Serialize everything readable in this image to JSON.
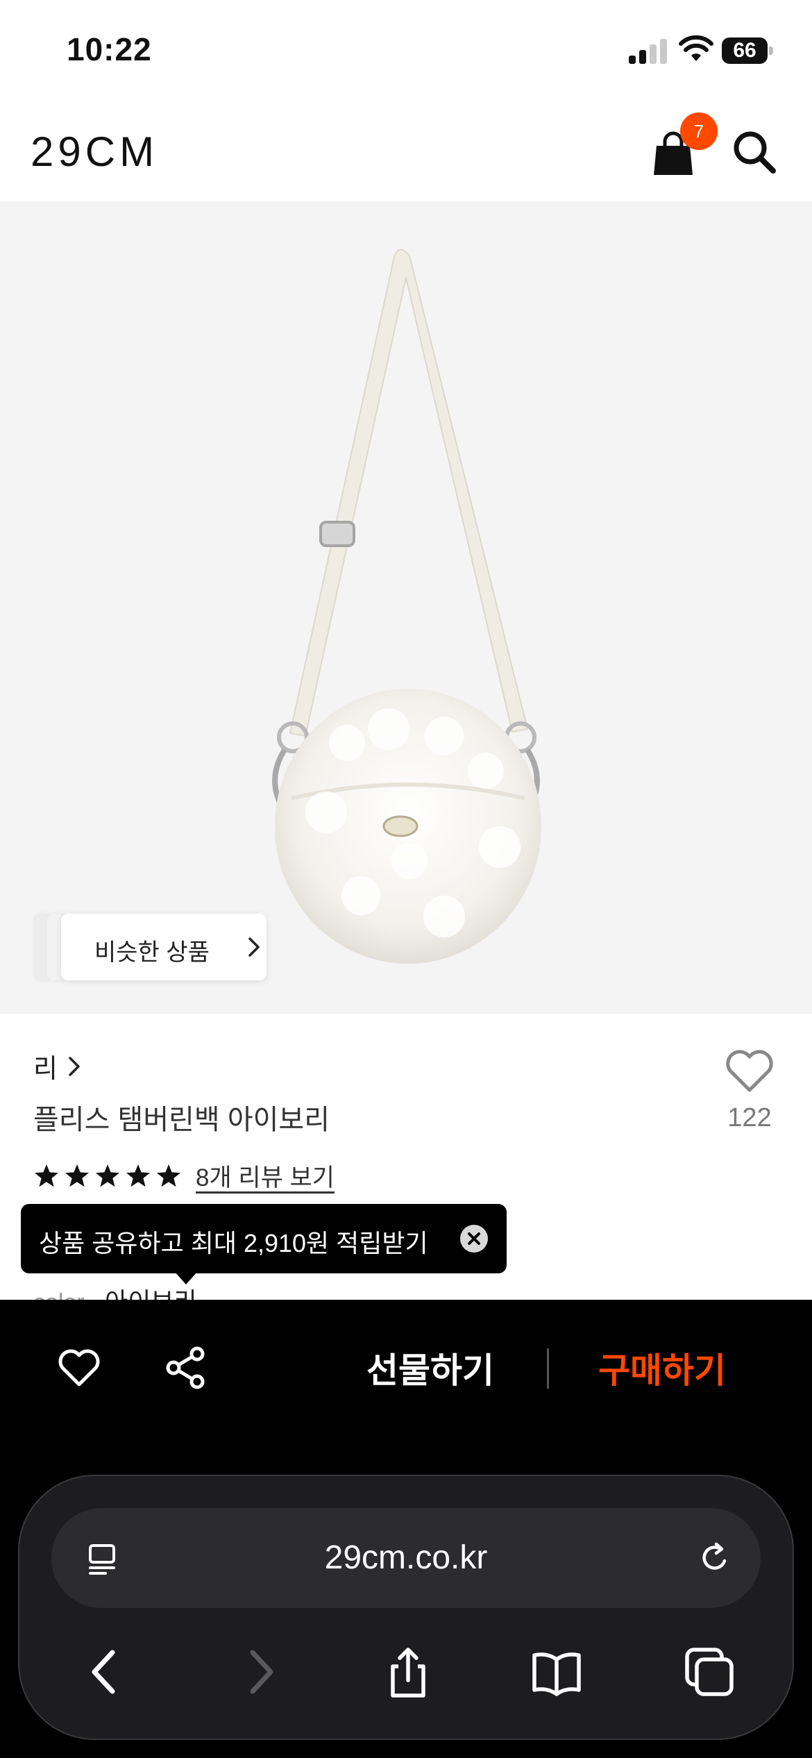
{
  "status_bar": {
    "time": "10:22",
    "battery": "66"
  },
  "header": {
    "logo": "29CM",
    "cart_count": "7"
  },
  "product_image": {
    "similar_label": "비슷한 상품"
  },
  "product": {
    "brand": "리",
    "name": "플리스 탬버린백 아이보리",
    "likes": "122",
    "rating_stars": 5,
    "review_link": "8개 리뷰 보기",
    "color_label": "color",
    "color_value": "아이보리"
  },
  "tooltip": {
    "text": "상품 공유하고 최대 2,910원 적립받기"
  },
  "action_bar": {
    "gift": "선물하기",
    "buy": "구매하기"
  },
  "browser": {
    "url": "29cm.co.kr"
  },
  "colors": {
    "accent": "#ff4800",
    "image_bg": "#f4f4f4",
    "bar_bg": "#000000"
  }
}
